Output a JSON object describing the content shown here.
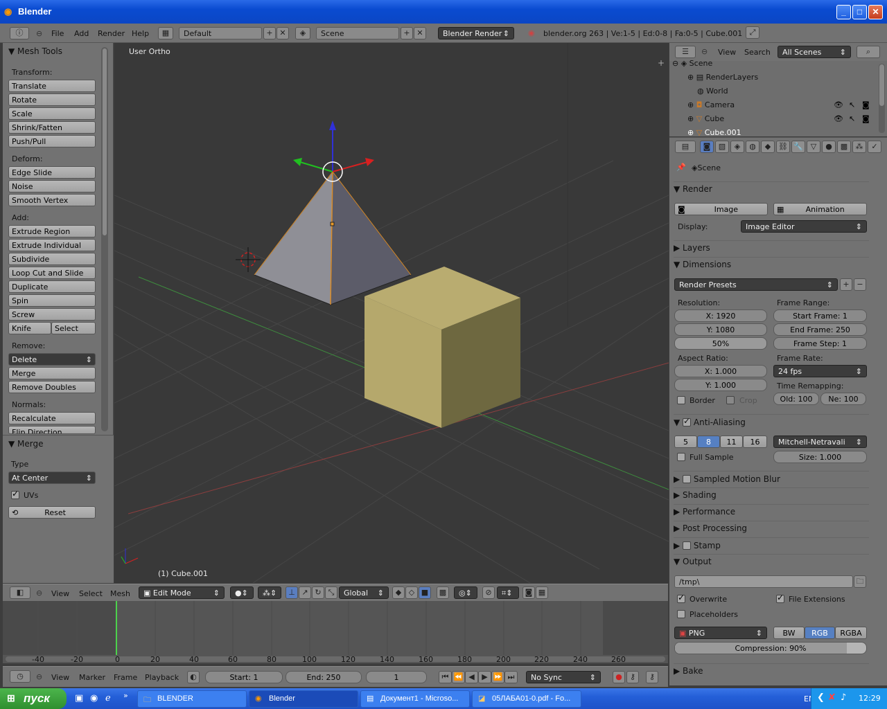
{
  "window": {
    "title": "Blender"
  },
  "info_header": {
    "menus": [
      "File",
      "Add",
      "Render",
      "Help"
    ],
    "layout": "Default",
    "scene": "Scene",
    "engine": "Blender Render",
    "stats": "blender.org 263 | Ve:1-5 | Ed:0-8 | Fa:0-5 | Cube.001"
  },
  "toolshelf": {
    "title": "Mesh Tools",
    "transform_label": "Transform:",
    "transform": [
      "Translate",
      "Rotate",
      "Scale",
      "Shrink/Fatten",
      "Push/Pull"
    ],
    "deform_label": "Deform:",
    "deform": [
      "Edge Slide",
      "Noise",
      "Smooth Vertex"
    ],
    "add_label": "Add:",
    "add": [
      "Extrude Region",
      "Extrude Individual",
      "Subdivide",
      "Loop Cut and Slide",
      "Duplicate",
      "Spin",
      "Screw"
    ],
    "knife": "Knife",
    "select": "Select",
    "remove_label": "Remove:",
    "delete": "Delete",
    "merge_btn": "Merge",
    "remove_doubles": "Remove Doubles",
    "normals_label": "Normals:",
    "recalculate": "Recalculate",
    "flip_direction": "Flip Direction",
    "merge_panel": "Merge",
    "type_label": "Type",
    "type_value": "At Center",
    "uvs": "UVs",
    "reset": "Reset"
  },
  "viewport": {
    "view_name": "User Ortho",
    "object_name": "(1) Cube.001"
  },
  "view3d_header": {
    "menus": [
      "View",
      "Select",
      "Mesh"
    ],
    "mode": "Edit Mode",
    "orientation": "Global"
  },
  "timeline": {
    "ruler": [
      "-40",
      "-20",
      "0",
      "20",
      "40",
      "60",
      "80",
      "100",
      "120",
      "140",
      "160",
      "180",
      "200",
      "220",
      "240",
      "260"
    ],
    "menus": [
      "View",
      "Marker",
      "Frame",
      "Playback"
    ],
    "start": "Start: 1",
    "end": "End: 250",
    "current": "1",
    "sync": "No Sync"
  },
  "outliner": {
    "view": "View",
    "search": "Search",
    "filter": "All Scenes",
    "items": [
      "Scene",
      "RenderLayers",
      "World",
      "Camera",
      "Cube",
      "Cube.001"
    ]
  },
  "properties": {
    "context": "Scene",
    "render_panel": "Render",
    "image_btn": "Image",
    "animation_btn": "Animation",
    "display_label": "Display:",
    "display_value": "Image Editor",
    "layers": "Layers",
    "dimensions": "Dimensions",
    "render_presets": "Render Presets",
    "resolution_label": "Resolution:",
    "res_x": "X: 1920",
    "res_y": "Y: 1080",
    "res_pct": "50%",
    "frame_range_label": "Frame Range:",
    "start_frame": "Start Frame: 1",
    "end_frame": "End Frame: 250",
    "frame_step": "Frame Step: 1",
    "aspect_label": "Aspect Ratio:",
    "aspect_x": "X: 1.000",
    "aspect_y": "Y: 1.000",
    "frame_rate_label": "Frame Rate:",
    "frame_rate": "24 fps",
    "time_remap_label": "Time Remapping:",
    "old": "Old: 100",
    "new": "Ne: 100",
    "border": "Border",
    "crop": "Crop",
    "anti_aliasing": "Anti-Aliasing",
    "aa_samples": [
      "5",
      "8",
      "11",
      "16"
    ],
    "aa_filter": "Mitchell-Netravali",
    "full_sample": "Full Sample",
    "size": "Size: 1.000",
    "sampled_motion_blur": "Sampled Motion Blur",
    "shading": "Shading",
    "performance": "Performance",
    "post_processing": "Post Processing",
    "stamp": "Stamp",
    "output": "Output",
    "output_path": "/tmp\\",
    "overwrite": "Overwrite",
    "file_extensions": "File Extensions",
    "placeholders": "Placeholders",
    "format": "PNG",
    "bw": "BW",
    "rgb": "RGB",
    "rgba": "RGBA",
    "compression": "Compression: 90%",
    "compression_value": 0.9,
    "bake": "Bake"
  },
  "taskbar": {
    "start": "пуск",
    "tasks": [
      "BLENDER",
      "Blender",
      "Документ1 - Microso...",
      "05ЛАБА01-0.pdf - Fo..."
    ],
    "lang": "EN",
    "clock": "12:29"
  },
  "colors": {
    "viewport_bg": "#393939",
    "cube": "#b5a86c",
    "pyramid_left": "#8f8f96",
    "pyramid_right": "#5c5c69",
    "selected_blue": "#5680c2",
    "timeline_cursor": "#4cd24c"
  }
}
